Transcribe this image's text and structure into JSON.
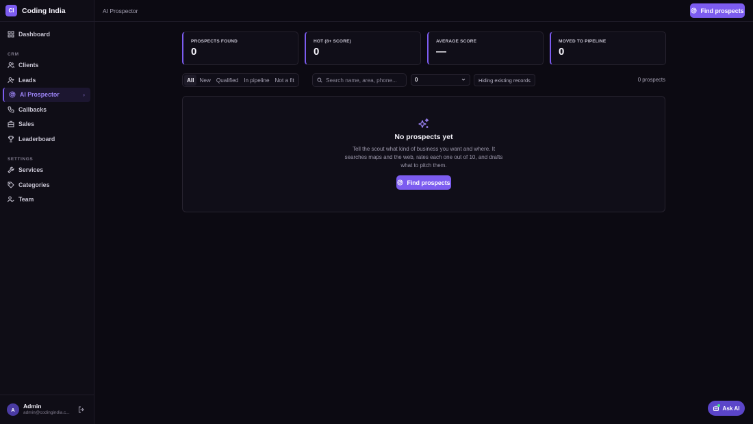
{
  "brand": {
    "logo": "CI",
    "name": "Coding India"
  },
  "sidebar": {
    "items": [
      {
        "label": "Dashboard",
        "icon": "grid-icon"
      },
      {
        "section": "CRM"
      },
      {
        "label": "Clients",
        "icon": "users-icon"
      },
      {
        "label": "Leads",
        "icon": "user-plus-icon"
      },
      {
        "label": "AI Prospector",
        "icon": "radar-icon",
        "active": true
      },
      {
        "label": "Callbacks",
        "icon": "phone-icon"
      },
      {
        "label": "Sales",
        "icon": "building-icon"
      },
      {
        "label": "Leaderboard",
        "icon": "trophy-icon"
      },
      {
        "section": "SETTINGS"
      },
      {
        "label": "Services",
        "icon": "wrench-icon"
      },
      {
        "label": "Categories",
        "icon": "tag-icon"
      },
      {
        "label": "Team",
        "icon": "team-icon"
      }
    ]
  },
  "user": {
    "initial": "A",
    "name": "Admin",
    "email": "admin@codingindia.c..."
  },
  "header": {
    "breadcrumb": "AI Prospector",
    "action_label": "Find prospects"
  },
  "stats": [
    {
      "label": "PROSPECTS FOUND",
      "value": "0"
    },
    {
      "label": "HOT (8+ SCORE)",
      "value": "0"
    },
    {
      "label": "AVERAGE SCORE",
      "value": "—"
    },
    {
      "label": "MOVED TO PIPELINE",
      "value": "0"
    }
  ],
  "filters": {
    "tabs": [
      "All",
      "New",
      "Qualified",
      "In pipeline",
      "Not a fit"
    ],
    "active_tab": "All",
    "search_placeholder": "Search name, area, phone...",
    "select_value": "0",
    "hiding_label": "Hiding existing records",
    "count_label": "0 prospects"
  },
  "empty_state": {
    "icon": "sparkles-icon",
    "title": "No prospects yet",
    "description": "Tell the scout what kind of business you want and where. It searches maps and the web, rates each one out of 10, and drafts what to pitch them.",
    "button_label": "Find prospects"
  },
  "assistant": {
    "label": "Ask AI",
    "icon": "bot-icon"
  },
  "colors": {
    "accent": "#7c5cf0",
    "background": "#0c0a12",
    "panel": "#100e18"
  }
}
